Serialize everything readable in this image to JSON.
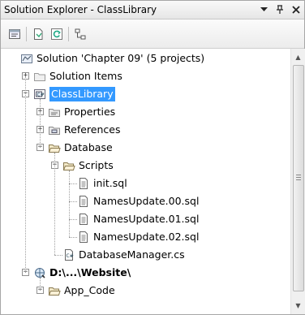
{
  "window": {
    "title": "Solution Explorer - ClassLibrary"
  },
  "titlebar_buttons": [
    "dropdown-arrow",
    "pin",
    "close"
  ],
  "toolbar": [
    {
      "name": "properties-icon"
    },
    {
      "name": "show-all-files-icon"
    },
    {
      "name": "refresh-icon"
    },
    {
      "name": "view-class-diagram-icon"
    }
  ],
  "tree": [
    {
      "label": "Solution 'Chapter 09' (5 projects)",
      "icon": "solution-icon",
      "level": 0,
      "expander": "none"
    },
    {
      "label": "Solution Items",
      "icon": "folder-icon",
      "level": 1,
      "expander": "plus"
    },
    {
      "label": "ClassLibrary",
      "icon": "csharp-project-icon",
      "level": 1,
      "expander": "minus",
      "selected": true
    },
    {
      "label": "Properties",
      "icon": "properties-folder-icon",
      "level": 2,
      "expander": "plus"
    },
    {
      "label": "References",
      "icon": "references-icon",
      "level": 2,
      "expander": "plus"
    },
    {
      "label": "Database",
      "icon": "folder-open-icon",
      "level": 2,
      "expander": "minus"
    },
    {
      "label": "Scripts",
      "icon": "folder-open-icon",
      "level": 3,
      "expander": "minus"
    },
    {
      "label": "init.sql",
      "icon": "sql-file-icon",
      "level": 4,
      "expander": "none"
    },
    {
      "label": "NamesUpdate.00.sql",
      "icon": "sql-file-icon",
      "level": 4,
      "expander": "none"
    },
    {
      "label": "NamesUpdate.01.sql",
      "icon": "sql-file-icon",
      "level": 4,
      "expander": "none"
    },
    {
      "label": "NamesUpdate.02.sql",
      "icon": "sql-file-icon",
      "level": 4,
      "expander": "none"
    },
    {
      "label": "DatabaseManager.cs",
      "icon": "cs-file-icon",
      "level": 3,
      "expander": "none"
    },
    {
      "label": "D:\\...\\Website\\",
      "icon": "website-icon",
      "level": 1,
      "expander": "minus",
      "bold": true
    },
    {
      "label": "App_Code",
      "icon": "folder-open-icon",
      "level": 2,
      "expander": "minus"
    }
  ],
  "colors": {
    "selection": "#3399ff",
    "selection_text": "#ffffff"
  }
}
